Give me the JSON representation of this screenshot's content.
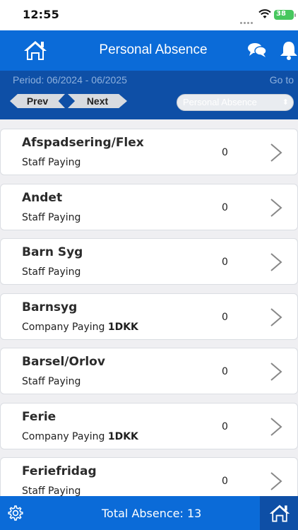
{
  "status": {
    "time": "12:55",
    "battery": "38"
  },
  "header": {
    "title": "Personal Absence"
  },
  "toolbar": {
    "period": "Period: 06/2024 - 06/2025",
    "goto": "Go to",
    "prev": "Prev",
    "next": "Next",
    "select_value": "Personal Absence"
  },
  "items": [
    {
      "title": "Afspadsering/Flex",
      "sub": "Staff Paying",
      "sub_bold": "",
      "value": "0"
    },
    {
      "title": "Andet",
      "sub": "Staff Paying",
      "sub_bold": "",
      "value": "0"
    },
    {
      "title": "Barn Syg",
      "sub": "Staff Paying",
      "sub_bold": "",
      "value": "0"
    },
    {
      "title": "Barnsyg",
      "sub": "Company Paying",
      "sub_bold": "1DKK",
      "value": "0"
    },
    {
      "title": "Barsel/Orlov",
      "sub": "Staff Paying",
      "sub_bold": "",
      "value": "0"
    },
    {
      "title": "Ferie",
      "sub": "Company Paying",
      "sub_bold": "1DKK",
      "value": "0"
    },
    {
      "title": "Feriefridag",
      "sub": "Staff Paying",
      "sub_bold": "",
      "value": "0"
    }
  ],
  "footer": {
    "total": "Total Absence: 13"
  },
  "icons": [
    "home-icon",
    "chat-icon",
    "bell-icon",
    "chevron-right-icon",
    "settings-icon",
    "wifi-icon",
    "battery-icon",
    "signal-icon"
  ],
  "colors": {
    "primary": "#0b6bd8",
    "toolbar": "#0e4fa6",
    "background": "#efeff2"
  }
}
